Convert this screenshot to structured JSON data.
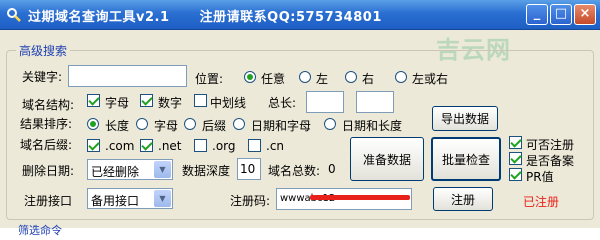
{
  "window": {
    "title": "过期域名查询工具v2.1      注册请联系QQ:575734801",
    "min_glyph": "_",
    "max_glyph": "□",
    "close_glyph": "×"
  },
  "watermark": "吉云网",
  "group": {
    "legend": "高级搜索"
  },
  "keyword": {
    "label": "关键字:",
    "value": ""
  },
  "position": {
    "label": "位置:",
    "options": [
      "任意",
      "左",
      "右",
      "左或右"
    ],
    "selected": "任意"
  },
  "structure": {
    "label": "域名结构:",
    "options": [
      {
        "label": "字母",
        "checked": true
      },
      {
        "label": "数字",
        "checked": true
      },
      {
        "label": "中划线",
        "checked": false
      }
    ],
    "total_length_label": "总长:",
    "length_min": "",
    "length_max": ""
  },
  "sort": {
    "label": "结果排序:",
    "options": [
      "长度",
      "字母",
      "后缀",
      "日期和字母",
      "日期和长度"
    ],
    "selected": "长度"
  },
  "suffix": {
    "label": "域名后缀:",
    "options": [
      {
        "label": ".com",
        "checked": true
      },
      {
        "label": ".net",
        "checked": true
      },
      {
        "label": ".org",
        "checked": false
      },
      {
        "label": ".cn",
        "checked": false
      }
    ]
  },
  "delete_date": {
    "label": "删除日期:",
    "value": "已经删除"
  },
  "depth": {
    "label": "数据深度",
    "value": "10"
  },
  "total": {
    "label": "域名总数:",
    "value": "0"
  },
  "api": {
    "label": "注册接口",
    "value": "备用接口"
  },
  "reg_code": {
    "label": "注册码:",
    "value": "wwwabc12"
  },
  "buttons": {
    "export": "导出数据",
    "prepare": "准备数据",
    "batch": "批量检查",
    "register": "注册"
  },
  "options_right": [
    {
      "label": "可否注册",
      "checked": true
    },
    {
      "label": "是否备案",
      "checked": true
    },
    {
      "label": "PR值",
      "checked": true
    }
  ],
  "status": "已注册",
  "bottom": "筛选命令"
}
